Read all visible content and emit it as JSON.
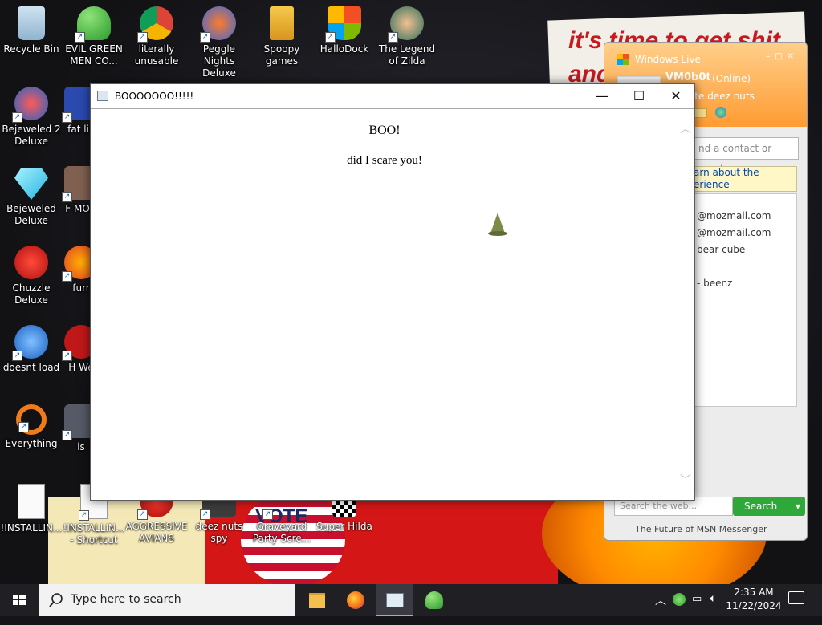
{
  "wallpaper": {
    "banner_text_line1": "it's time to get shit",
    "banner_text_line2": "and",
    "vote_text": "VOTE"
  },
  "desktop_icons": [
    {
      "label": "Recycle Bin",
      "icon": "recycle-bin-icon",
      "shortcut": false
    },
    {
      "label": "EVIL GREEN MEN CO...",
      "icon": "msn-people-icon",
      "shortcut": true
    },
    {
      "label": "literally unusable",
      "icon": "chrome-icon",
      "shortcut": true
    },
    {
      "label": "Peggle Nights Deluxe",
      "icon": "peggle-icon",
      "shortcut": true
    },
    {
      "label": "Spoopy games",
      "icon": "folder-icon",
      "shortcut": false
    },
    {
      "label": "HalloDock",
      "icon": "windows-logo-icon",
      "shortcut": true
    },
    {
      "label": "The Legend of Zilda",
      "icon": "zelda-icon",
      "shortcut": true
    },
    {
      "label": "Bejeweled 2 Deluxe",
      "icon": "bejeweled-2-icon",
      "shortcut": true
    },
    {
      "label": "fat lik",
      "icon": "app-icon",
      "shortcut": true
    },
    {
      "label": "Bejeweled Deluxe",
      "icon": "diamond-icon",
      "shortcut": true
    },
    {
      "label": "F MON",
      "icon": "app-icon",
      "shortcut": true
    },
    {
      "label": "Chuzzle Deluxe",
      "icon": "chuzzle-icon",
      "shortcut": false
    },
    {
      "label": "furr",
      "icon": "firefox-icon",
      "shortcut": true
    },
    {
      "label": "doesnt load",
      "icon": "thunderbird-icon",
      "shortcut": true
    },
    {
      "label": "H We",
      "icon": "app-icon",
      "shortcut": true
    },
    {
      "label": "Everything",
      "icon": "everything-search-icon",
      "shortcut": true
    },
    {
      "label": "is",
      "icon": "app-icon",
      "shortcut": true
    },
    {
      "label": "!INSTALLIN...",
      "icon": "text-file-icon",
      "shortcut": false
    },
    {
      "label": "!INSTALLIN... - Shortcut",
      "icon": "text-file-icon",
      "shortcut": true
    },
    {
      "label": "AGGRESSIVE AVIANS",
      "icon": "angry-bird-icon",
      "shortcut": true
    },
    {
      "label": "deez nuts spy",
      "icon": "app-icon",
      "shortcut": true
    },
    {
      "label": "Graveyard Party Scre...",
      "icon": "app-icon",
      "shortcut": true
    },
    {
      "label": "Super Hilda",
      "icon": "app-icon",
      "shortcut": false
    }
  ],
  "msn": {
    "title": "Windows Live",
    "username": "VM0b0t",
    "status": "(Online)",
    "personal_message": "rate deez nuts",
    "search_contacts_placeholder": "nd a contact or numbe",
    "info_line1": "arn about the",
    "info_line2": "erience",
    "contacts": [
      "@mozmail.com",
      "@mozmail.com",
      "bear cube",
      "- beenz"
    ],
    "web_search_placeholder": "Search the web...",
    "search_button": "Search",
    "footer": "The Future of MSN Messenger"
  },
  "window": {
    "title": "BOOOOOOO!!!!!",
    "heading": "BOO!",
    "text": "did I scare you!",
    "minimize": "—",
    "maximize": "☐",
    "close": "✕"
  },
  "taskbar": {
    "search_placeholder": "Type here to search",
    "time": "2:35 AM",
    "date": "11/22/2024",
    "apps": [
      "file-explorer-icon",
      "firefox-icon",
      "window-app-icon",
      "msn-people-icon"
    ]
  },
  "colors": {
    "taskbar": "#1f1f24",
    "msn_header": "#ff9b33",
    "search_green": "#2fa83a",
    "accent_blue": "#79b8ff"
  }
}
